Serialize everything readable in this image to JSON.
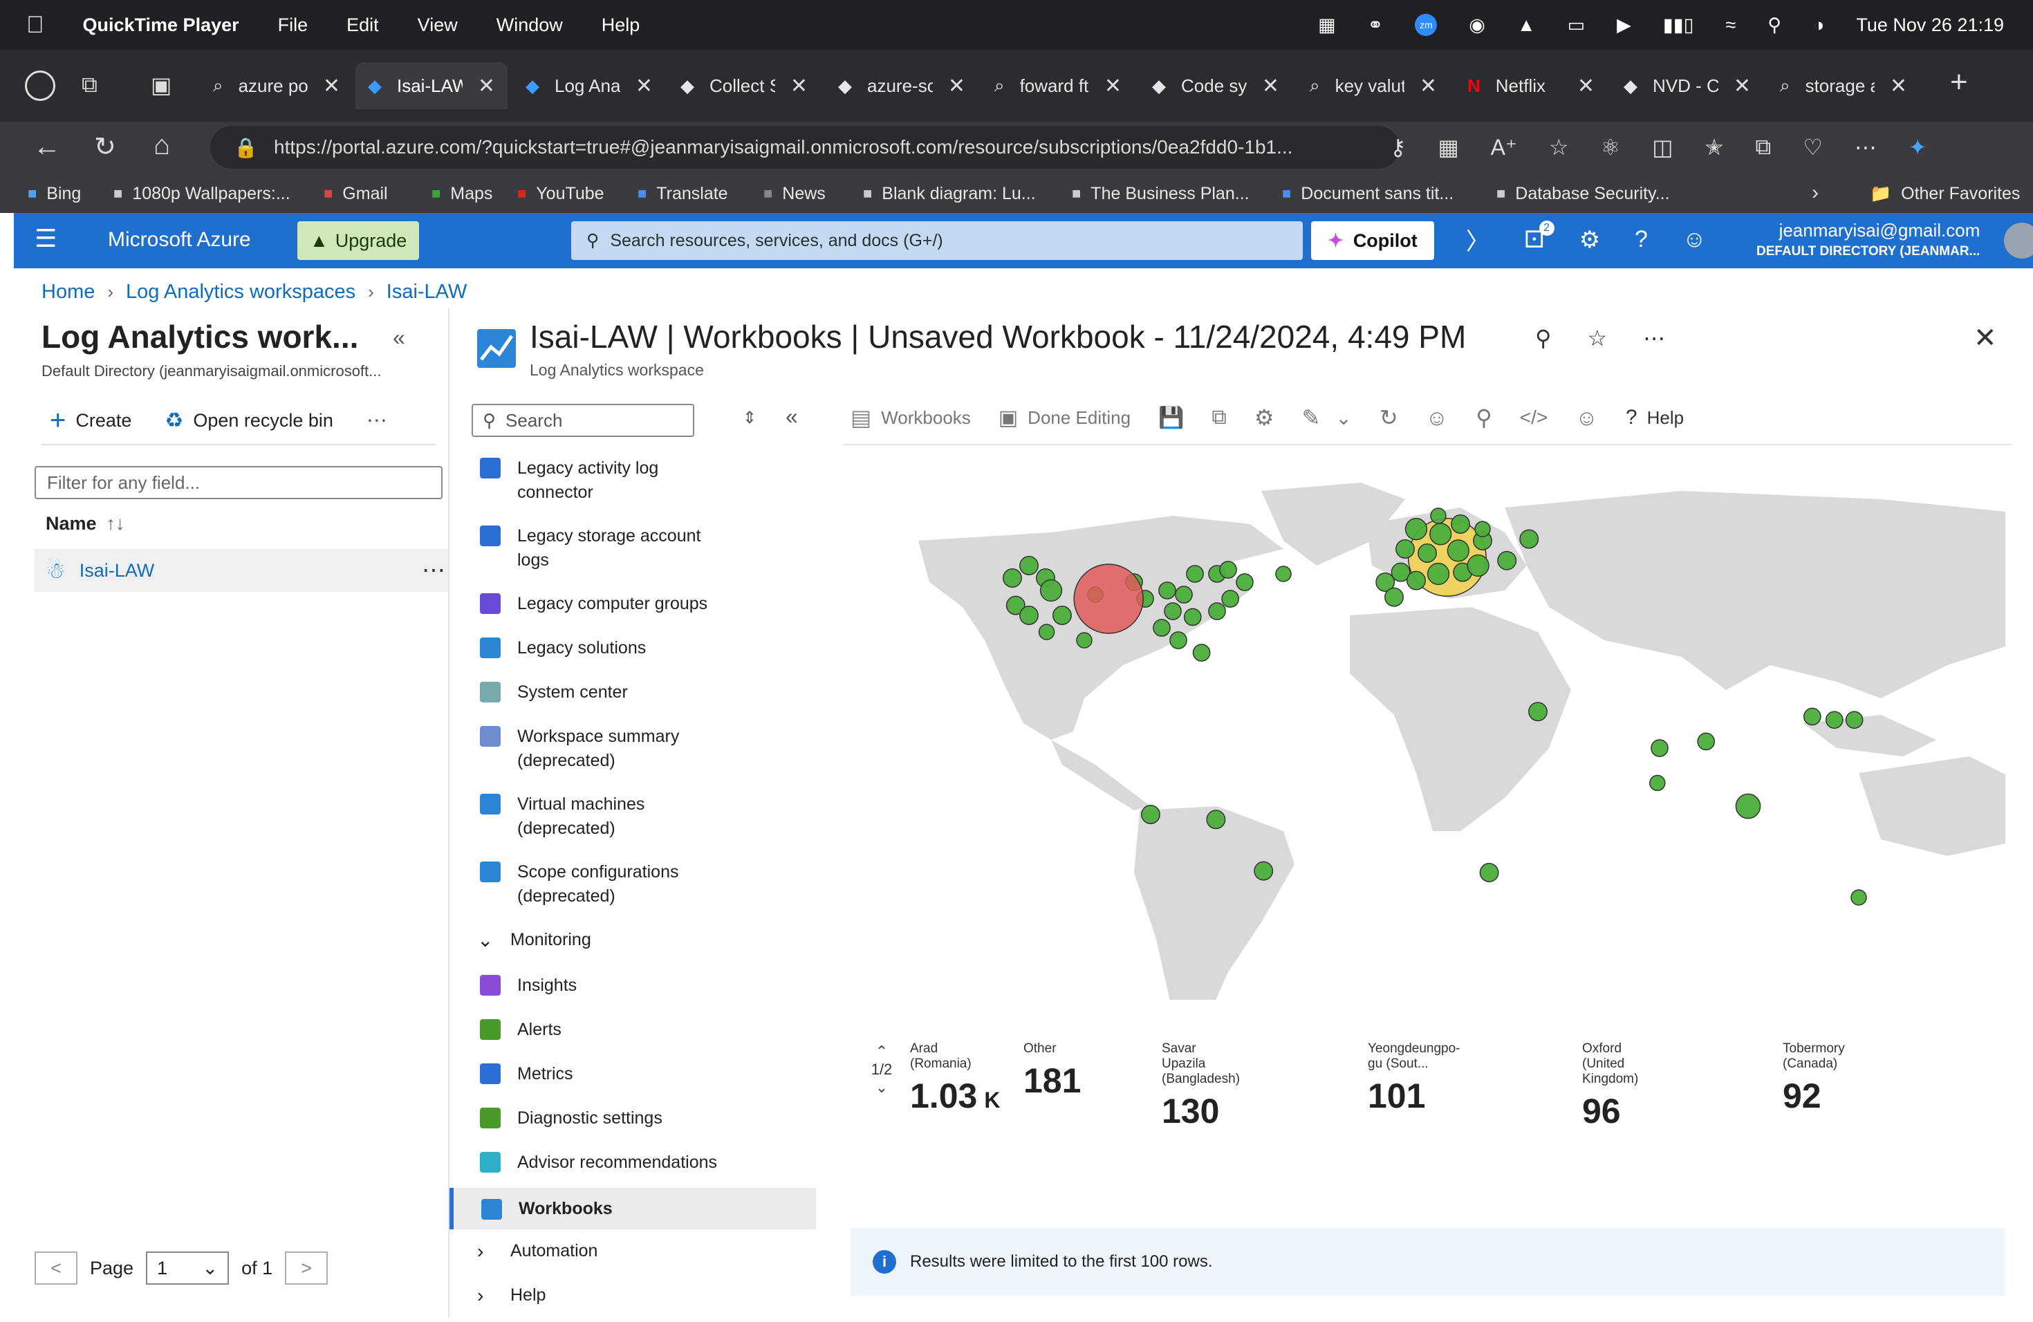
{
  "macos_menu": {
    "app_name": "QuickTime Player",
    "items": [
      "File",
      "Edit",
      "View",
      "Window",
      "Help"
    ],
    "clock": "Tue Nov 26  21:19"
  },
  "browser": {
    "tabs": [
      {
        "label": "azure por",
        "icon": "search-icon"
      },
      {
        "label": "Isai-LAW",
        "icon": "azure-icon",
        "active": true
      },
      {
        "label": "Log Analy",
        "icon": "azure-icon"
      },
      {
        "label": "Collect S",
        "icon": "microsoft-icon"
      },
      {
        "label": "azure-so",
        "icon": "github-icon"
      },
      {
        "label": "foward ft",
        "icon": "search-icon"
      },
      {
        "label": "Code syn",
        "icon": "openai-icon"
      },
      {
        "label": "key valut",
        "icon": "search-icon"
      },
      {
        "label": "Netflix",
        "icon": "netflix-icon"
      },
      {
        "label": "NVD - C\\",
        "icon": "nvd-icon"
      },
      {
        "label": "storage a",
        "icon": "search-icon"
      }
    ],
    "url": "https://portal.azure.com/?quickstart=true#@jeanmaryisaigmail.onmicrosoft.com/resource/subscriptions/0ea2fdd0-1b1...",
    "favorites": [
      {
        "label": "Bing",
        "icon": "bing-icon"
      },
      {
        "label": "1080p Wallpapers:...",
        "icon": "wallpaper-icon"
      },
      {
        "label": "Gmail",
        "icon": "gmail-icon"
      },
      {
        "label": "Maps",
        "icon": "maps-icon"
      },
      {
        "label": "YouTube",
        "icon": "youtube-icon"
      },
      {
        "label": "Translate",
        "icon": "translate-icon"
      },
      {
        "label": "News",
        "icon": "news-icon"
      },
      {
        "label": "Blank diagram: Lu...",
        "icon": "lucid-icon"
      },
      {
        "label": "The Business Plan...",
        "icon": "doc-icon"
      },
      {
        "label": "Document sans tit...",
        "icon": "gdoc-icon"
      },
      {
        "label": "Database Security...",
        "icon": "db-icon"
      }
    ],
    "other_favorites": "Other Favorites"
  },
  "azure_bar": {
    "brand": "Microsoft Azure",
    "upgrade": "Upgrade",
    "search_placeholder": "Search resources, services, and docs (G+/)",
    "copilot": "Copilot",
    "notifications_count": "2",
    "user_email": "jeanmaryisai@gmail.com",
    "user_directory": "DEFAULT DIRECTORY (JEANMAR..."
  },
  "breadcrumb": [
    "Home",
    "Log Analytics workspaces",
    "Isai-LAW"
  ],
  "left_pane": {
    "title": "Log Analytics work...",
    "subtitle": "Default Directory (jeanmaryisaigmail.onmicrosoft...",
    "create": "Create",
    "recycle": "Open recycle bin",
    "filter_placeholder": "Filter for any field...",
    "name_header": "Name",
    "rows": [
      "Isai-LAW"
    ],
    "pager": {
      "page_label": "Page",
      "page_value": "1",
      "of_label": "of 1"
    }
  },
  "blade": {
    "title": "Isai-LAW | Workbooks | Unsaved Workbook - 11/24/2024, 4:49 PM",
    "subtitle": "Log Analytics workspace"
  },
  "nav_menu": {
    "search_placeholder": "Search",
    "items": [
      {
        "label": "Legacy activity log connector",
        "icon": "activity-log-icon"
      },
      {
        "label": "Legacy storage account logs",
        "icon": "storage-icon"
      },
      {
        "label": "Legacy computer groups",
        "icon": "computer-groups-icon"
      },
      {
        "label": "Legacy solutions",
        "icon": "solutions-icon"
      },
      {
        "label": "System center",
        "icon": "system-center-icon"
      },
      {
        "label": "Workspace summary (deprecated)",
        "icon": "summary-icon"
      },
      {
        "label": "Virtual machines (deprecated)",
        "icon": "vm-icon"
      },
      {
        "label": "Scope configurations (deprecated)",
        "icon": "scope-icon"
      }
    ],
    "monitoring_section": "Monitoring",
    "monitoring_items": [
      {
        "label": "Insights",
        "icon": "insights-icon"
      },
      {
        "label": "Alerts",
        "icon": "alerts-icon"
      },
      {
        "label": "Metrics",
        "icon": "metrics-icon"
      },
      {
        "label": "Diagnostic settings",
        "icon": "diagnostic-icon"
      },
      {
        "label": "Advisor recommendations",
        "icon": "advisor-icon"
      },
      {
        "label": "Workbooks",
        "icon": "workbooks-icon",
        "selected": true
      }
    ],
    "automation_section": "Automation",
    "help_section": "Help"
  },
  "toolbar": {
    "workbooks": "Workbooks",
    "done_editing": "Done Editing",
    "help": "Help"
  },
  "map_colors": {
    "land": "#d9d9d9",
    "green": "#4caf3c",
    "red": "#e05a5a",
    "yellow": "#f2d14a"
  },
  "tiles": {
    "pager": "1/2",
    "items": [
      {
        "label": "Arad (Romania)",
        "value": "1.03",
        "unit": "K"
      },
      {
        "label": "Other",
        "value": "181",
        "unit": ""
      },
      {
        "label": "Savar Upazila (Bangladesh)",
        "value": "130",
        "unit": ""
      },
      {
        "label": "Yeongdeungpo-gu (Sout...",
        "value": "101",
        "unit": ""
      },
      {
        "label": "Oxford (United Kingdom)",
        "value": "96",
        "unit": ""
      },
      {
        "label": "Tobermory (Canada)",
        "value": "92",
        "unit": ""
      }
    ]
  },
  "info_message": "Results were limited to the first 100 rows."
}
